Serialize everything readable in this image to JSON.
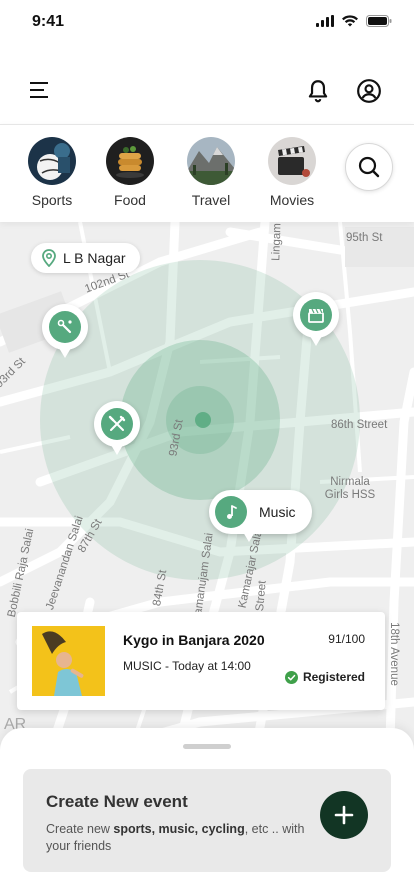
{
  "status_bar": {
    "time": "9:41"
  },
  "categories": [
    {
      "label": "Sports"
    },
    {
      "label": "Food"
    },
    {
      "label": "Travel"
    },
    {
      "label": "Movies"
    }
  ],
  "map": {
    "location": "L B Nagar",
    "streets": [
      "95th St",
      "102nd St",
      "93rd St",
      "93rd St",
      "86th Street",
      "Nirmala Girls HSS",
      "87th St",
      "84th St",
      "Bobbili Raja Salai",
      "Jeevanandan Salai",
      "Ramanujam Salai",
      "Kamarajar Salai",
      "Street",
      "18th Avenue",
      "Lingam",
      "AR"
    ],
    "music_pin_label": "Music"
  },
  "event": {
    "title": "Kygo in Banjara 2020",
    "count": "91/100",
    "subtitle": "MUSIC - Today at 14:00",
    "status": "Registered"
  },
  "create": {
    "title": "Create New event",
    "desc_prefix": "Create new ",
    "desc_bold": "sports, music, cycling",
    "desc_suffix": ", etc .. with your friends"
  },
  "colors": {
    "accent": "#56a97f",
    "fab": "#123524"
  }
}
